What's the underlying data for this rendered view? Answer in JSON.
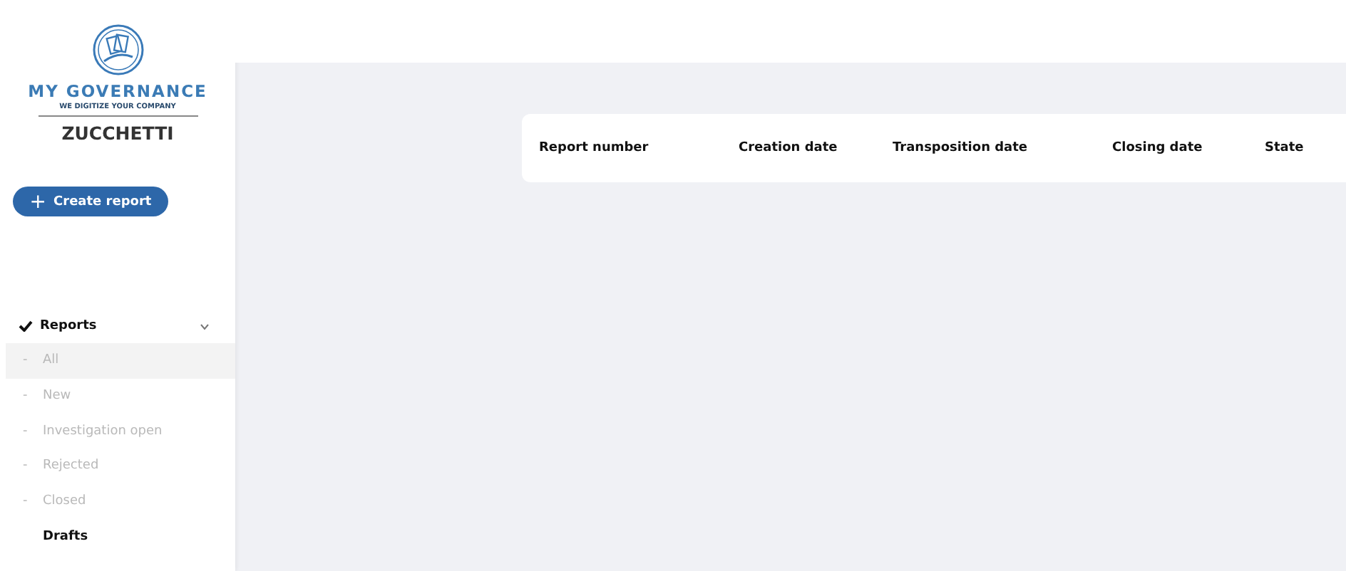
{
  "brand": {
    "title": "MY GOVERNANCE",
    "tagline": "WE DIGITIZE YOUR COMPANY",
    "company": "ZUCCHETTI"
  },
  "create_button": {
    "icon": "+",
    "label": "Create report"
  },
  "sidebar": {
    "section": {
      "label": "Reports",
      "expanded": true
    },
    "items": [
      {
        "bullet": "-",
        "label": "All",
        "highlighted": true,
        "selected": false
      },
      {
        "bullet": "-",
        "label": "New",
        "highlighted": false,
        "selected": false
      },
      {
        "bullet": "-",
        "label": "Investigation open",
        "highlighted": false,
        "selected": false
      },
      {
        "bullet": "-",
        "label": "Rejected",
        "highlighted": false,
        "selected": false
      },
      {
        "bullet": "-",
        "label": "Closed",
        "highlighted": false,
        "selected": false
      },
      {
        "label": "Drafts",
        "highlighted": false,
        "selected": true
      }
    ]
  },
  "table": {
    "columns": [
      "Report number",
      "Creation date",
      "Transposition date",
      "Closing date",
      "State"
    ]
  }
}
